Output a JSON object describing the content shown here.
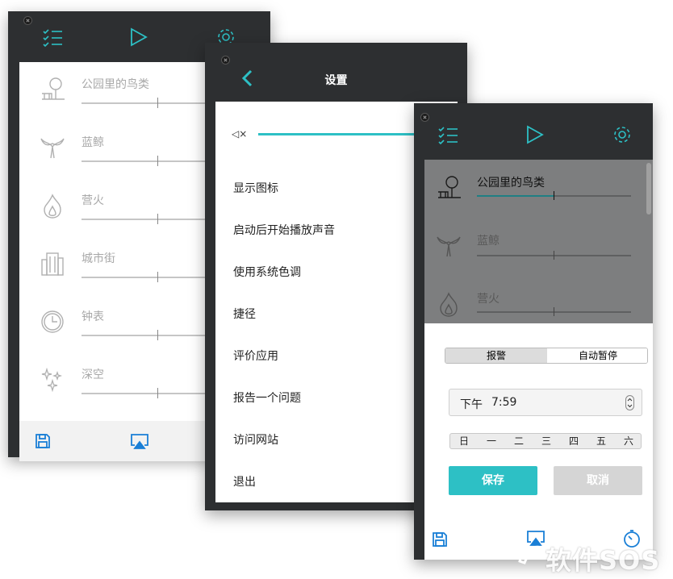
{
  "colors": {
    "accent": "#2dc0c5",
    "dark": "#2d2f31",
    "save_button": "#2dc0c5",
    "cancel_button": "#d5d5d5"
  },
  "window_sounds": {
    "toolbar_icons": [
      "checklist-icon",
      "play-icon",
      "gear-icon"
    ],
    "sounds": [
      {
        "label": "公园里的鸟类",
        "icon": "park-icon"
      },
      {
        "label": "蓝鲸",
        "icon": "whale-tail-icon"
      },
      {
        "label": "营火",
        "icon": "flame-icon"
      },
      {
        "label": "城市街",
        "icon": "building-icon"
      },
      {
        "label": "钟表",
        "icon": "clock-icon"
      },
      {
        "label": "深空",
        "icon": "sparkles-icon"
      }
    ],
    "footer_icons": [
      "save-icon",
      "airplay-icon"
    ]
  },
  "window_settings": {
    "title": "设置",
    "mute_label": "◁×",
    "menu": [
      "显示图标",
      "启动后开始播放声音",
      "使用系统色调",
      "捷径",
      "评价应用",
      "报告一个问题",
      "访问网站",
      "退出"
    ]
  },
  "window_timer": {
    "sounds": [
      "公园里的鸟类",
      "蓝鲸",
      "营火"
    ],
    "tabs": [
      "报警",
      "自动暂停"
    ],
    "selected_tab": "报警",
    "time_ampm": "下午",
    "time_value": "7:59",
    "days": [
      "日",
      "一",
      "二",
      "三",
      "四",
      "五",
      "六"
    ],
    "save_label": "保存",
    "cancel_label": "取消",
    "footer_icons": [
      "save-icon",
      "airplay-icon",
      "timer-icon"
    ]
  },
  "watermark": "软件SOS"
}
